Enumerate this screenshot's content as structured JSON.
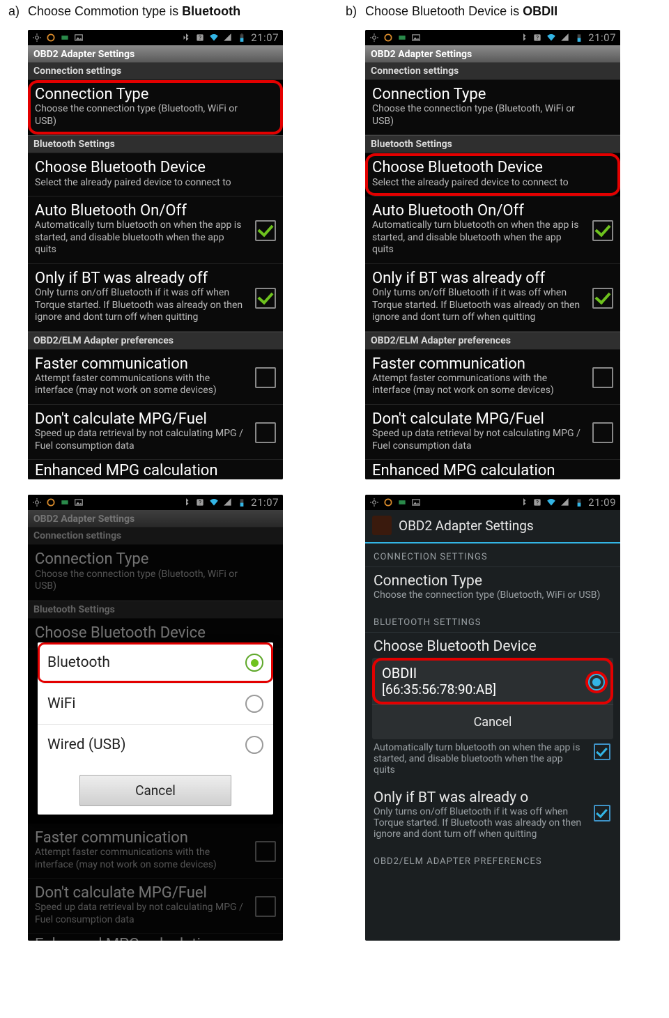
{
  "caption_a": {
    "label": "a)",
    "pre": "Choose ",
    "mono": "Commotion",
    "post": " type is ",
    "bold": "Bluetooth"
  },
  "caption_b": {
    "label": "b)",
    "text": "Choose Bluetooth Device is ",
    "bold": "OBDII"
  },
  "status": {
    "time": "21:07",
    "time_b": "21:09"
  },
  "app_header": "OBD2 Adapter Settings",
  "sections": {
    "conn": "Connection settings",
    "bt": "Bluetooth Settings",
    "elm": "OBD2/ELM Adapter preferences",
    "conn_uc": "CONNECTION SETTINGS",
    "bt_uc": "BLUETOOTH SETTINGS",
    "elm_uc": "OBD2/ELM ADAPTER PREFERENCES"
  },
  "items": {
    "conn_type": {
      "title": "Connection Type",
      "sub": "Choose the connection type (Bluetooth, WiFi or USB)"
    },
    "choose_bt": {
      "title": "Choose Bluetooth Device",
      "sub": "Select the already paired device to connect to"
    },
    "auto_bt": {
      "title": "Auto Bluetooth On/Off",
      "sub": "Automatically turn bluetooth on when the app is started, and disable bluetooth when the app quits"
    },
    "auto_bt_wrap": {
      "sub": "Automatically turn bluetooth on when the app is started, and disable bluetooth when the app quits"
    },
    "only_if": {
      "title": "Only if BT was already off",
      "sub": "Only turns on/off Bluetooth if it was off when Torque started. If Bluetooth was already on then ignore and dont turn off when quitting"
    },
    "only_if_cut": {
      "title": "Only if BT was already o",
      "sub": "Only turns on/off Bluetooth if it was off when Torque started. If Bluetooth was already on then ignore and dont turn off when quitting"
    },
    "faster": {
      "title": "Faster communication",
      "sub": "Attempt faster communications with the interface (may not work on some devices)"
    },
    "mpg": {
      "title": "Don't calculate MPG/Fuel",
      "sub": "Speed up data retrieval by not calculating MPG / Fuel consumption data"
    },
    "enhanced": {
      "title": "Enhanced MPG calculation"
    }
  },
  "dialog_conn": {
    "options": [
      {
        "label": "Bluetooth",
        "selected": true
      },
      {
        "label": "WiFi",
        "selected": false
      },
      {
        "label": "Wired (USB)",
        "selected": false
      }
    ],
    "cancel": "Cancel"
  },
  "dialog_bt": {
    "device": "OBDII",
    "mac": "[66:35:56:78:90:AB]",
    "cancel": "Cancel"
  }
}
